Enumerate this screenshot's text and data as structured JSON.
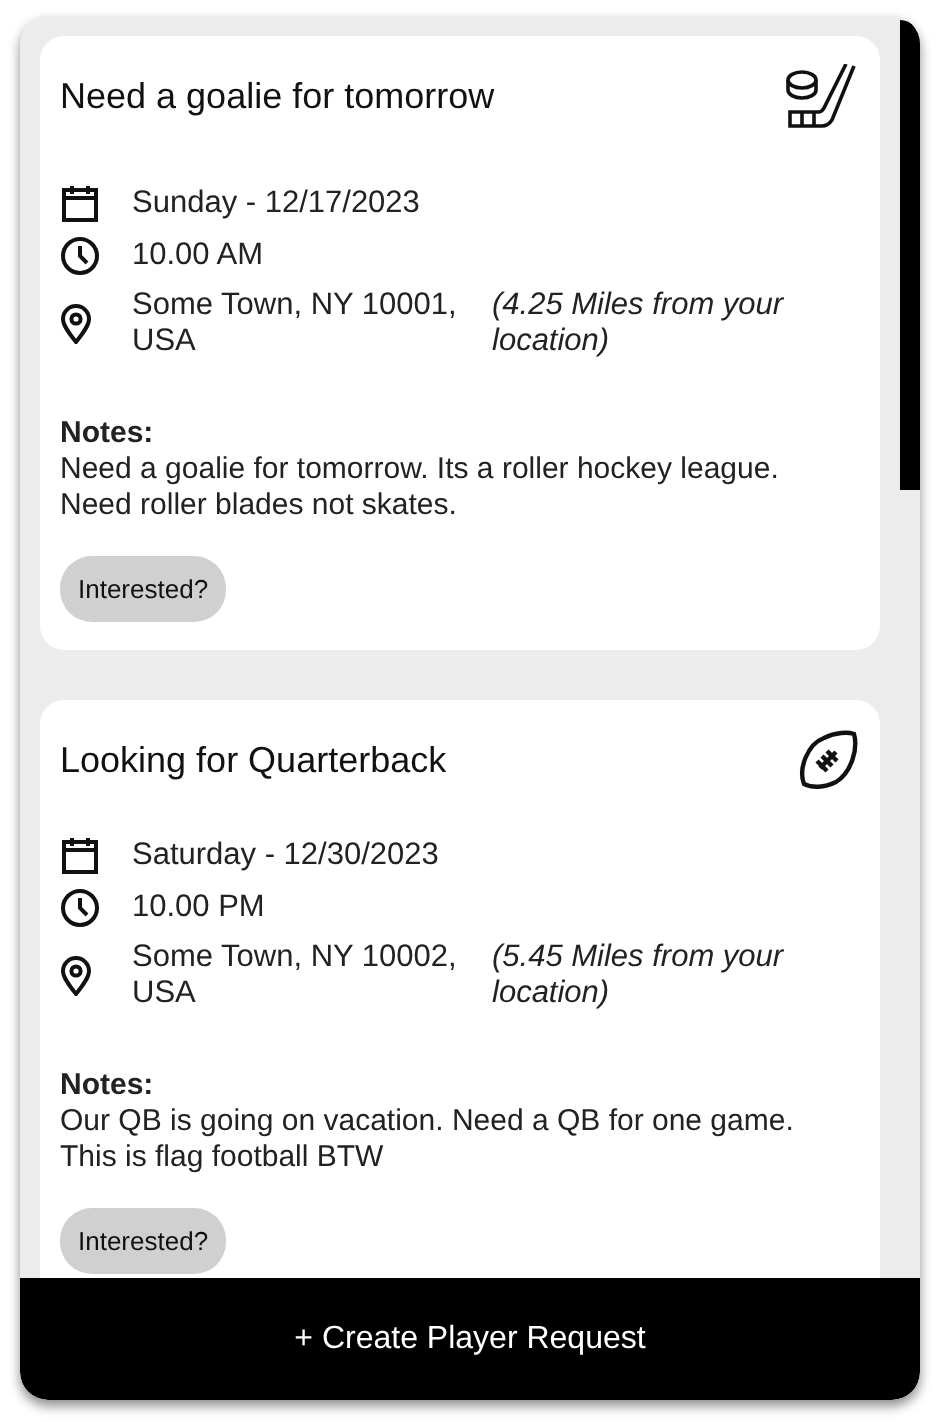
{
  "requests": [
    {
      "title": "Need a goalie for tomorrow",
      "kind": "hockey",
      "date": "Sunday - 12/17/2023",
      "time": "10.00 AM",
      "address": "Some Town, NY 10001, USA",
      "distance": "(4.25 Miles from your location)",
      "notes_label": "Notes:",
      "notes": "Need a goalie for tomorrow. Its a roller hockey league. Need roller blades not skates.",
      "button": "Interested?"
    },
    {
      "title": "Looking for Quarterback",
      "kind": "football",
      "date": "Saturday - 12/30/2023",
      "time": "10.00 PM",
      "address": "Some Town, NY 10002, USA",
      "distance": "(5.45 Miles from your location)",
      "notes_label": "Notes:",
      "notes": "Our QB is going on vacation. Need a QB for one game. This is flag football BTW",
      "button": "Interested?"
    }
  ],
  "create_button": "+ Create Player Request"
}
